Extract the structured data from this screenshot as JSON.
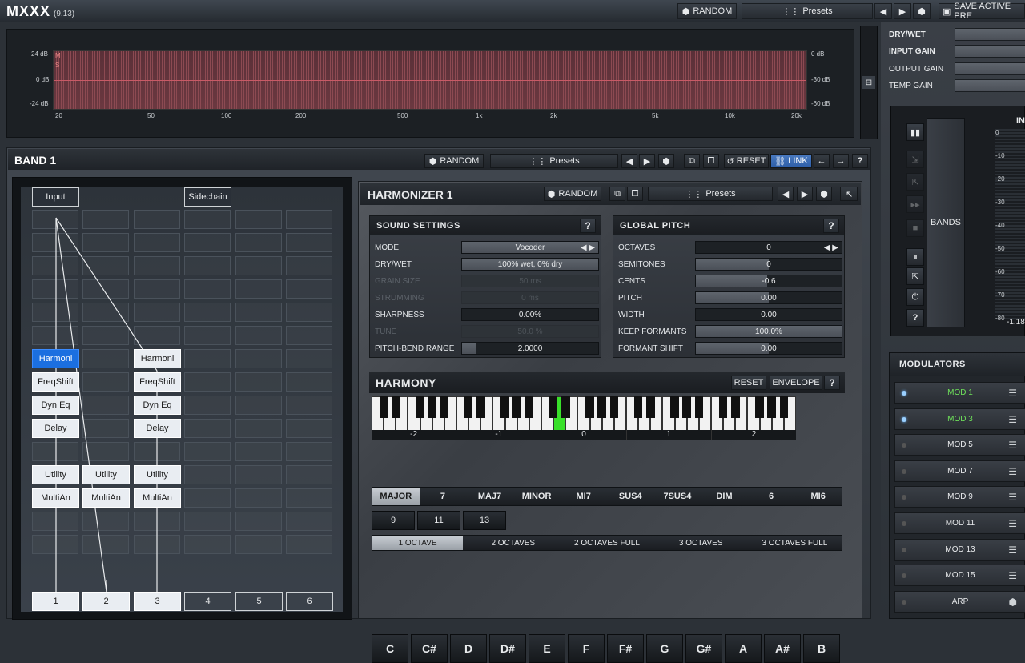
{
  "app": {
    "title": "MXXX",
    "version": "(9.13)"
  },
  "topbar": {
    "random": "RANDOM",
    "presets": "Presets",
    "save": "SAVE ACTIVE PRE"
  },
  "eq": {
    "left_db": [
      "24 dB",
      "0 dB",
      "-24 dB"
    ],
    "right_db": [
      "0 dB",
      "-30 dB",
      "-60 dB"
    ],
    "freqs": [
      "20",
      "50",
      "100",
      "200",
      "500",
      "1k",
      "2k",
      "5k",
      "10k",
      "20k"
    ],
    "markers": [
      "M",
      "S"
    ]
  },
  "master": {
    "drywet": "DRY/WET",
    "input_gain": "INPUT GAIN",
    "output_gain": "OUTPUT GAIN",
    "temp_gain": "TEMP GAIN"
  },
  "band": {
    "title": "BAND 1",
    "random": "RANDOM",
    "presets": "Presets",
    "reset": "RESET",
    "link": "LINK"
  },
  "routing": {
    "input": "Input",
    "sidechain": "Sidechain",
    "col1": [
      "Harmoni",
      "FreqShift",
      "Dyn Eq",
      "Delay",
      "Utility",
      "MultiAn"
    ],
    "col2": [
      "Utility",
      "MultiAn"
    ],
    "col3": [
      "Harmoni",
      "FreqShift",
      "Dyn Eq",
      "Delay",
      "Utility",
      "MultiAn"
    ],
    "outputs": [
      "1",
      "2",
      "3",
      "4",
      "5",
      "6"
    ]
  },
  "harmonizer": {
    "title": "HARMONIZER 1",
    "random": "RANDOM",
    "presets": "Presets"
  },
  "sound": {
    "title": "SOUND SETTINGS",
    "mode_l": "MODE",
    "mode_v": "Vocoder",
    "drywet_l": "DRY/WET",
    "drywet_v": "100% wet, 0% dry",
    "grain_l": "GRAIN SIZE",
    "grain_v": "50 ms",
    "str_l": "STRUMMING",
    "str_v": "0 ms",
    "sharp_l": "SHARPNESS",
    "sharp_v": "0.00%",
    "tune_l": "TUNE",
    "tune_v": "50.0 %",
    "pbr_l": "PITCH-BEND RANGE",
    "pbr_v": "2.0000"
  },
  "pitch": {
    "title": "GLOBAL PITCH",
    "oct_l": "OCTAVES",
    "oct_v": "0",
    "semi_l": "SEMITONES",
    "semi_v": "0",
    "cents_l": "CENTS",
    "cents_v": "-0.6",
    "pitch_l": "PITCH",
    "pitch_v": "0.00",
    "width_l": "WIDTH",
    "width_v": "0.00",
    "kf_l": "KEEP FORMANTS",
    "kf_v": "100.0%",
    "fs_l": "FORMANT SHIFT",
    "fs_v": "0.00"
  },
  "harmony": {
    "title": "HARMONY",
    "reset": "RESET",
    "envelope": "ENVELOPE",
    "octaves": [
      "-2",
      "-1",
      "0",
      "1",
      "2"
    ],
    "notes": [
      "C",
      "C#",
      "D",
      "D#",
      "E",
      "F",
      "F#",
      "G",
      "G#",
      "A",
      "A#",
      "B"
    ],
    "chords": [
      "MAJOR",
      "7",
      "MAJ7",
      "MINOR",
      "MI7",
      "SUS4",
      "7SUS4",
      "DIM",
      "6",
      "MI6"
    ],
    "ext": [
      "9",
      "11",
      "13"
    ],
    "ranges": [
      "1 OCTAVE",
      "2 OCTAVES",
      "2 OCTAVES FULL",
      "3 OCTAVES",
      "3 OCTAVES FULL"
    ]
  },
  "meter": {
    "in": "IN",
    "bands": "BANDS",
    "scale": [
      "0",
      "-10",
      "-20",
      "-30",
      "-40",
      "-50",
      "-60",
      "-70",
      "-80"
    ],
    "readout": "-1.18"
  },
  "modulators": {
    "title": "MODULATORS",
    "items": [
      "MOD 1",
      "MOD 3",
      "MOD 5",
      "MOD 7",
      "MOD 9",
      "MOD 11",
      "MOD 13",
      "MOD 15",
      "ARP"
    ]
  },
  "colors": {
    "accent": "#1b6fe0",
    "mod_active": "#6ee05a",
    "key_active": "#39e02a"
  }
}
